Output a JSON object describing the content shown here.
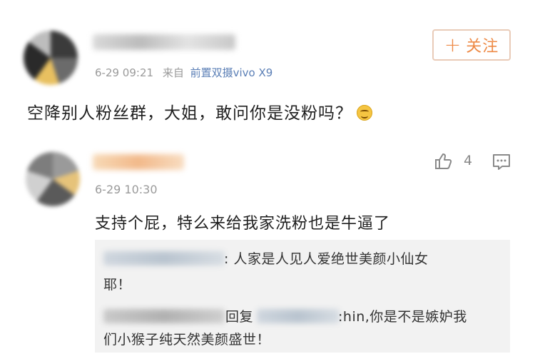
{
  "post": {
    "time": "6-29 09:21",
    "source_prefix": "来自",
    "source": "前置双摄vivo X9",
    "follow_label": "关注",
    "follow_plus": "+",
    "text": "空降别人粉丝群，大姐，敢问你是没粉吗？"
  },
  "comment": {
    "time": "6-29 10:30",
    "like_count": "4",
    "text": "支持个屁，特么来给我家洗粉也是牛逼了"
  },
  "replies": [
    {
      "text_line1": ": 人家是人见人爱绝世美颜小仙女",
      "text_line2": "耶！"
    },
    {
      "reply_word": "回复",
      "text_line1": ":hin,你是不是嫉妒我",
      "text_line2": "们小猴子纯天然美颜盛世！"
    }
  ],
  "icons": {
    "like": "thumbs-up-icon",
    "comment": "comment-icon",
    "emoji": "smile-emoji-icon"
  },
  "colors": {
    "follow": "#ee8a46",
    "source_link": "#5b7fb6",
    "meta": "#9a9a9a",
    "reply_bg": "#f2f2f2"
  }
}
